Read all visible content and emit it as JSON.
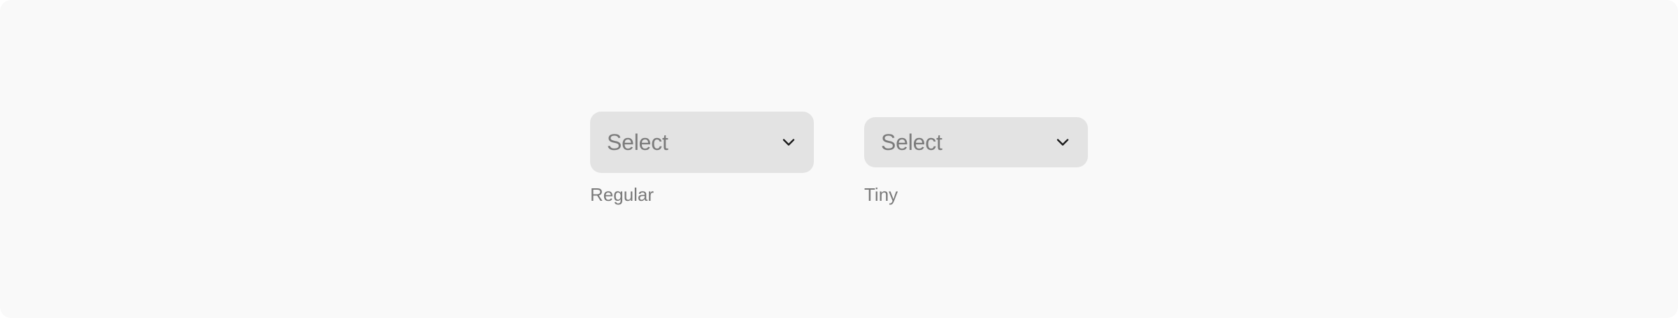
{
  "colors": {
    "page_background": "#f9f9f9",
    "select_background": "#e3e3e3",
    "placeholder_text": "#7b7b7b",
    "chevron": "#1a1a1a",
    "caption_text": "#7a7a7a"
  },
  "variants": [
    {
      "select": {
        "placeholder": "Select",
        "icon": "chevron-down-icon"
      },
      "caption": "Regular"
    },
    {
      "select": {
        "placeholder": "Select",
        "icon": "chevron-down-icon"
      },
      "caption": "Tiny"
    }
  ]
}
